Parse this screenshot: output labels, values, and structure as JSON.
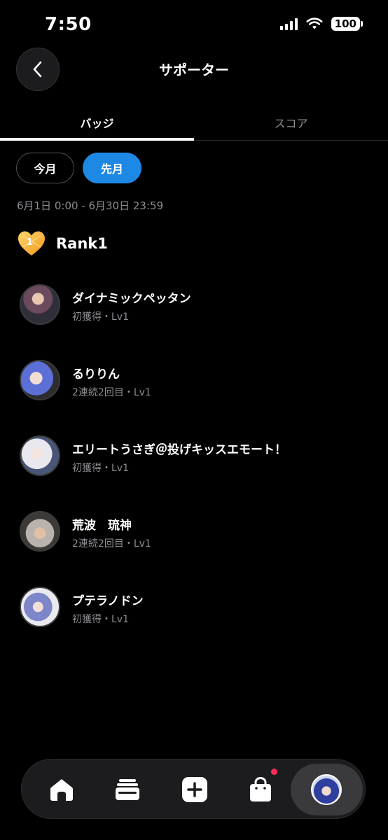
{
  "status_bar": {
    "time": "7:50",
    "battery": "100"
  },
  "header": {
    "title": "サポーター",
    "back_icon": "chevron-left-icon"
  },
  "tabs": [
    {
      "label": "バッジ",
      "active": true
    },
    {
      "label": "スコア",
      "active": false
    }
  ],
  "period": {
    "this_month": "今月",
    "last_month": "先月",
    "selected": "先月",
    "date_range": "6月1日 0:00 - 6月30日 23:59"
  },
  "rank": {
    "label": "Rank1",
    "badge_number": "1",
    "badge_icon": "heart-badge-icon",
    "badge_color": "#f5a623"
  },
  "supporters": [
    {
      "name": "ダイナミックペッタン",
      "sub": "初獲得・Lv1"
    },
    {
      "name": "るりりん",
      "sub": "2連続2回目・Lv1"
    },
    {
      "name": "エリートうさぎ＠投げキッスエモート！",
      "sub": "初獲得・Lv1"
    },
    {
      "name": "荒波　琉神",
      "sub": "2連続2回目・Lv1"
    },
    {
      "name": "プテラノドン",
      "sub": "初獲得・Lv1"
    }
  ],
  "bottom_nav": {
    "items": [
      "home-icon",
      "stack-icon",
      "plus-icon",
      "shop-bag-icon",
      "profile-avatar"
    ],
    "accent": "#1e88e5",
    "notification_color": "#ff2d55"
  }
}
